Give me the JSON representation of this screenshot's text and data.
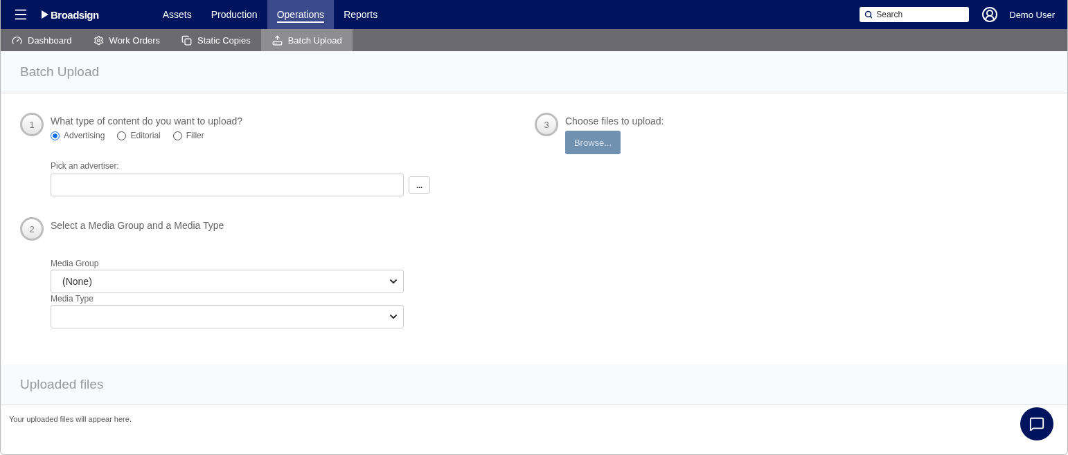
{
  "topbar": {
    "brand": "Broadsign",
    "nav": [
      {
        "label": "Assets",
        "selected": false
      },
      {
        "label": "Production",
        "selected": false
      },
      {
        "label": "Operations",
        "selected": true
      },
      {
        "label": "Reports",
        "selected": false
      }
    ],
    "search": {
      "placeholder": "Search"
    },
    "user": "Demo User"
  },
  "subnav": [
    {
      "label": "Dashboard",
      "kind": "gauge",
      "selected": false
    },
    {
      "label": "Work Orders",
      "kind": "gears",
      "selected": false
    },
    {
      "label": "Static Copies",
      "kind": "copies",
      "selected": false
    },
    {
      "label": "Batch Upload",
      "kind": "upload",
      "selected": true
    }
  ],
  "page_title": "Batch Upload",
  "step1": {
    "number": "1",
    "question": "What type of content do you want to upload?",
    "options": [
      {
        "label": "Advertising",
        "selected": true
      },
      {
        "label": "Editorial",
        "selected": false
      },
      {
        "label": "Filler",
        "selected": false
      }
    ],
    "advertiser_label": "Pick an advertiser:",
    "picker_button": "..."
  },
  "step2": {
    "number": "2",
    "title": "Select a Media Group and a Media Type",
    "media_group_label": "Media Group",
    "media_group_value": "(None)",
    "media_type_label": "Media Type"
  },
  "step3": {
    "number": "3",
    "title": "Choose files to upload:",
    "button": "Browse...",
    "disabled": true
  },
  "uploaded": {
    "title": "Uploaded files",
    "message": "Your uploaded files will appear here."
  }
}
